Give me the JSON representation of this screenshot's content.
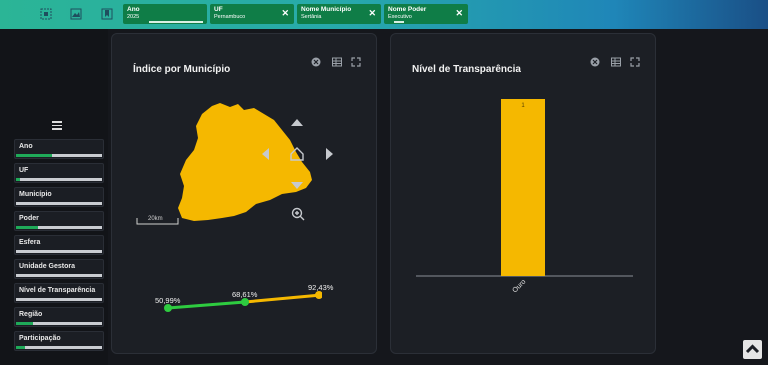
{
  "filters_bar": {
    "chips": [
      {
        "title": "Ano",
        "value": "2025"
      },
      {
        "title": "UF",
        "value": "Pernambuco"
      },
      {
        "title": "Nome Município",
        "value": "Sertânia"
      },
      {
        "title": "Nome Poder",
        "value": "Executivo"
      }
    ],
    "close_glyph": "✕",
    "toolbar_icons": [
      "select-icon",
      "image-icon",
      "bookmark-icon"
    ]
  },
  "sidebar": {
    "filters": [
      {
        "label": "Ano",
        "fill": 0.42
      },
      {
        "label": "UF",
        "fill": 0.05
      },
      {
        "label": "Município",
        "fill": 0.0
      },
      {
        "label": "Poder",
        "fill": 0.25
      },
      {
        "label": "Esfera",
        "fill": 0.0
      },
      {
        "label": "Unidade Gestora",
        "fill": 0.0
      },
      {
        "label": "Nível de Transparência",
        "fill": 0.0
      },
      {
        "label": "Região",
        "fill": 0.2
      },
      {
        "label": "Participação",
        "fill": 0.1
      }
    ]
  },
  "map_card": {
    "title": "Índice por Município",
    "scale_label": "20km",
    "region_color": "#f5b800",
    "scale_values": [
      "50,99%",
      "68,61%",
      "92,43%"
    ],
    "scale_colors": [
      "#2ecc40",
      "#2ecc40",
      "#f5b800"
    ]
  },
  "chart_card": {
    "title": "Nível de Transparência"
  },
  "chart_data": {
    "type": "bar",
    "categories": [
      "Ouro"
    ],
    "values": [
      1
    ],
    "data_labels": [
      "1"
    ],
    "title": "Nível de Transparência",
    "xlabel": "",
    "ylabel": "",
    "ylim": [
      0,
      1
    ],
    "grid": false,
    "color": "#f5b800"
  },
  "colors": {
    "accent_green": "#0f7d47",
    "bar": "#f5b800"
  }
}
